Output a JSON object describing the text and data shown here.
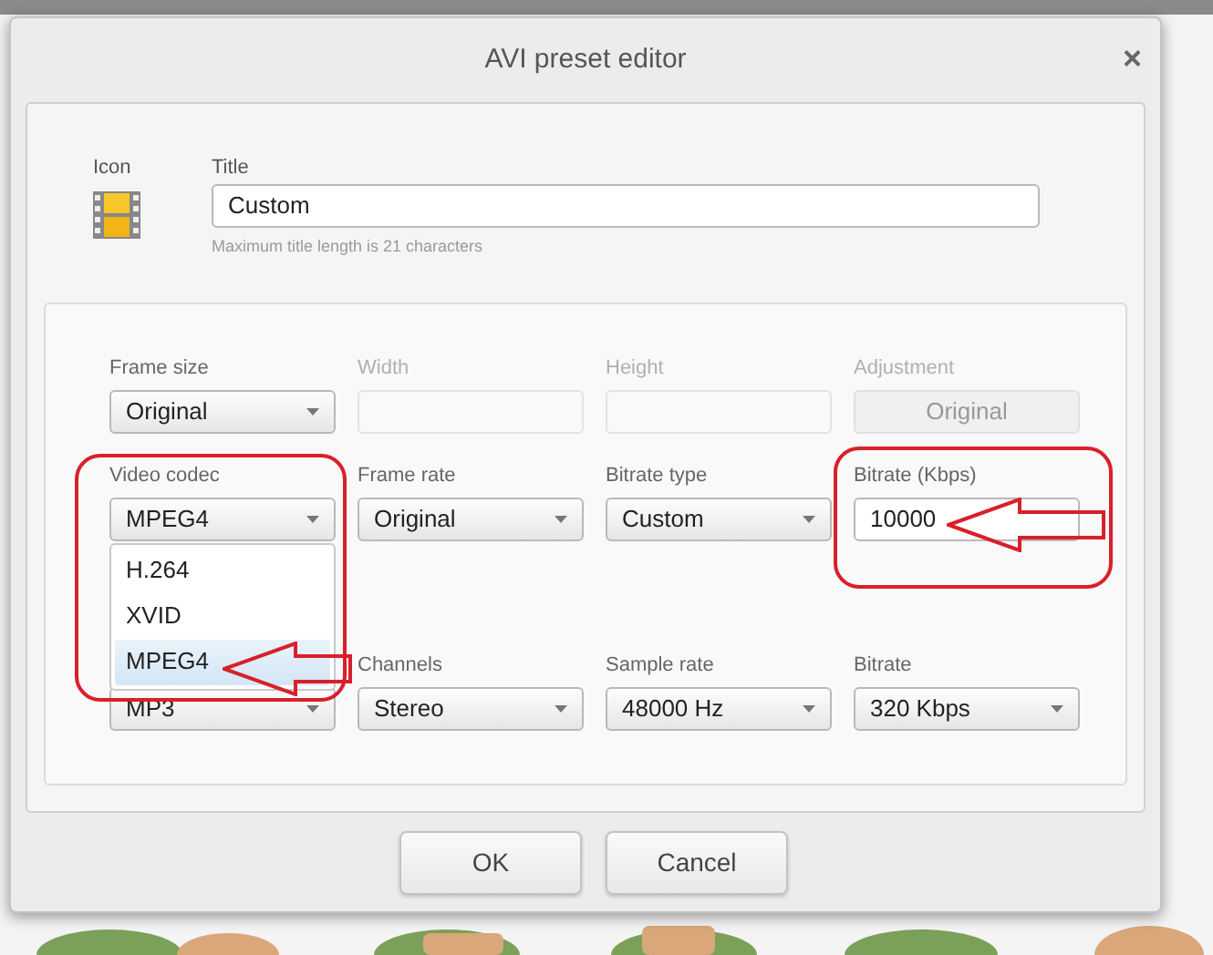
{
  "window": {
    "title": "AVI preset editor",
    "close": "×"
  },
  "icon_label": "Icon",
  "title_field": {
    "label": "Title",
    "value": "Custom",
    "hint": "Maximum title length is 21 characters"
  },
  "rows": [
    {
      "fields": [
        {
          "kind": "select",
          "label": "Frame size",
          "value": "Original"
        },
        {
          "kind": "input",
          "label": "Width",
          "disabled": true
        },
        {
          "kind": "input",
          "label": "Height",
          "disabled": true
        },
        {
          "kind": "button",
          "label": "Adjustment",
          "value": "Original",
          "disabled": true
        }
      ]
    },
    {
      "fields": [
        {
          "kind": "select",
          "label": "Video codec",
          "value": "MPEG4",
          "open": true,
          "options": [
            {
              "label": "H.264",
              "selected": false
            },
            {
              "label": "XVID",
              "selected": false
            },
            {
              "label": "MPEG4",
              "selected": true
            }
          ]
        },
        {
          "kind": "select",
          "label": "Frame rate",
          "value": "Original"
        },
        {
          "kind": "select",
          "label": "Bitrate type",
          "value": "Custom"
        },
        {
          "kind": "input",
          "label": "Bitrate (Kbps)",
          "value": "10000",
          "disabled": false
        }
      ]
    },
    {
      "fields": [
        {
          "kind": "select",
          "value": "MP3"
        },
        {
          "kind": "select",
          "label": "Channels",
          "value": "Stereo"
        },
        {
          "kind": "select",
          "label": "Sample rate",
          "value": "48000 Hz"
        },
        {
          "kind": "select",
          "label": "Bitrate",
          "value": "320 Kbps"
        }
      ]
    }
  ],
  "buttons": [
    "OK",
    "Cancel"
  ]
}
